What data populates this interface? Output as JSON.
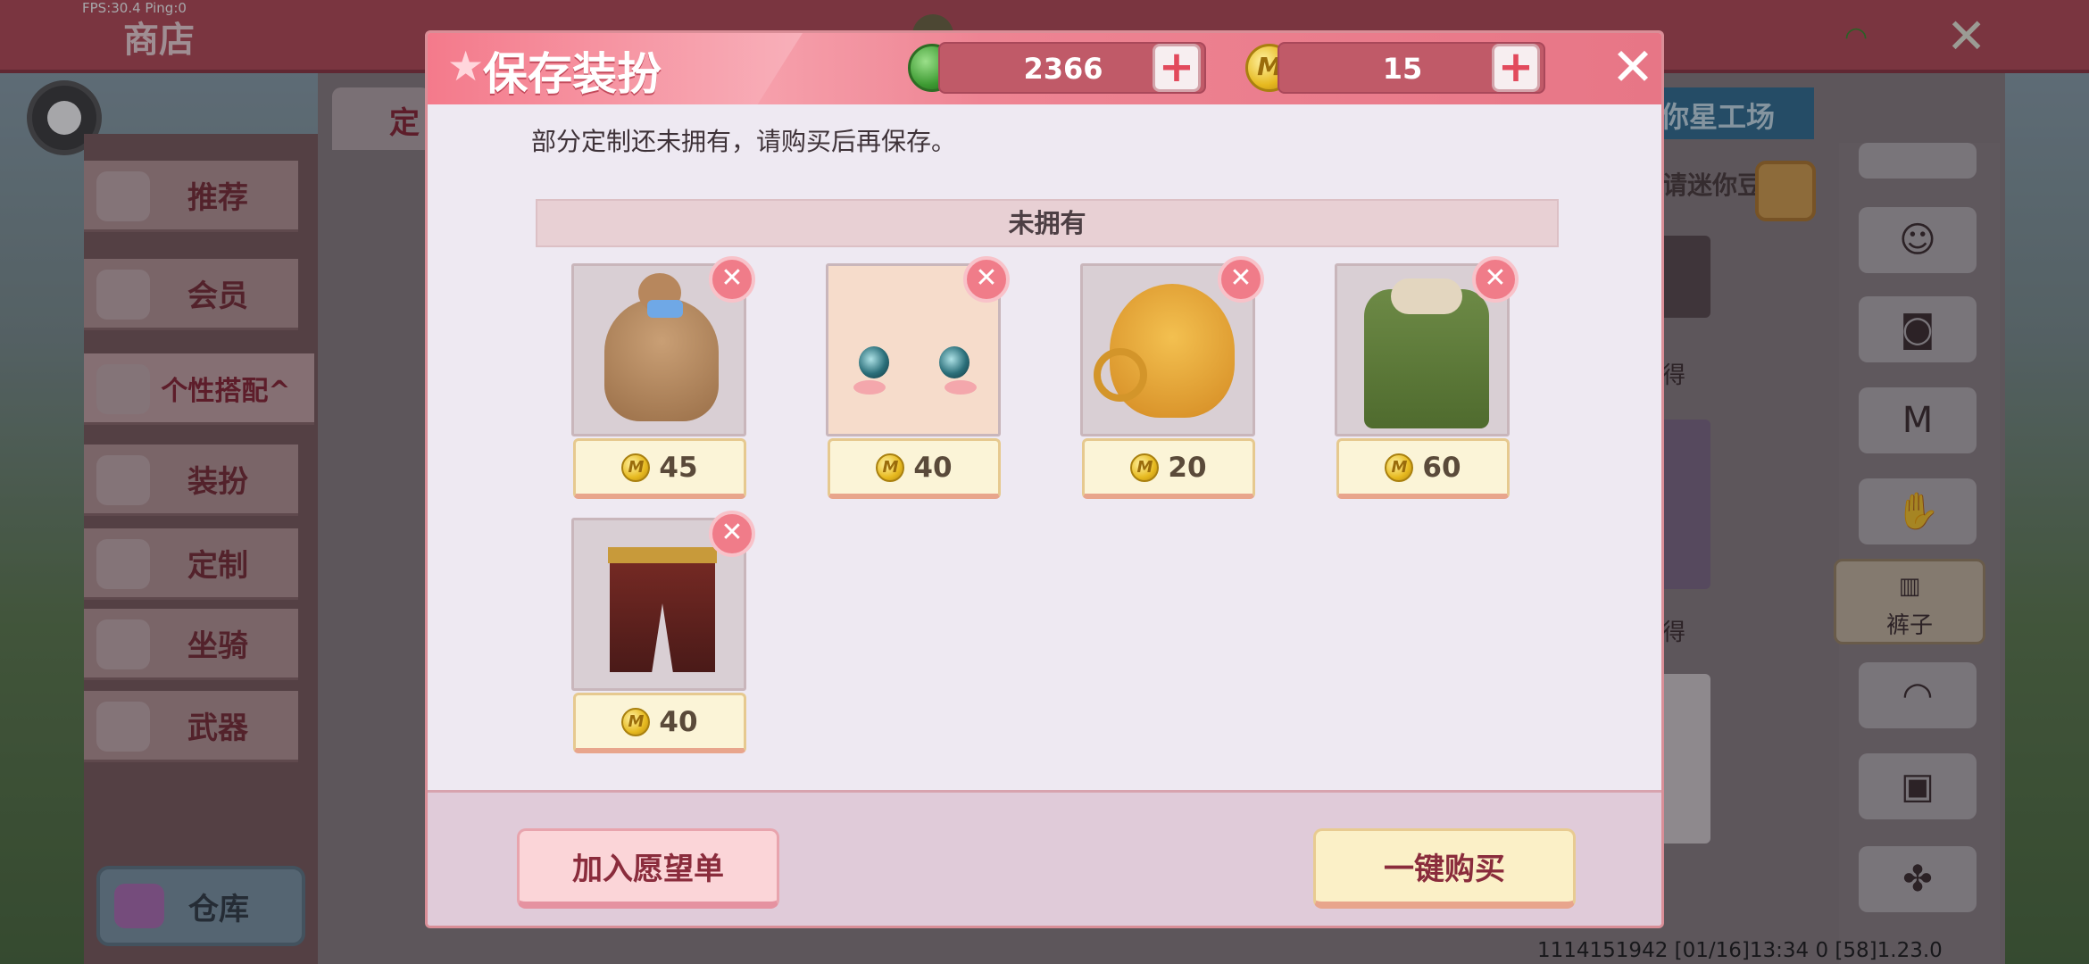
{
  "debug": {
    "fps": "FPS:30.4  Ping:0"
  },
  "background": {
    "shop_title": "商店",
    "tab_left": "定",
    "tab_right": "你星工场",
    "search_hint": "请迷你豆",
    "sidebar": [
      {
        "label": "推荐"
      },
      {
        "label": "会员"
      },
      {
        "label": "个性搭配^"
      },
      {
        "label": "装扮"
      },
      {
        "label": "定制"
      },
      {
        "label": "坐骑"
      },
      {
        "label": "武器"
      }
    ],
    "warehouse": "仓库",
    "right_panel_active": "裤子",
    "partial_char": "得",
    "footer": "1114151942      [01/16]13:34 0    [58]1.23.0"
  },
  "dialog": {
    "title": "保存装扮",
    "gems": "2366",
    "coins": "15",
    "coin_symbol": "M",
    "notice": "部分定制还未拥有，请购买后再保存。",
    "section_header": "未拥有",
    "items": [
      {
        "name": "hair",
        "price": "45"
      },
      {
        "name": "face",
        "price": "40"
      },
      {
        "name": "dog-accessory",
        "price": "20"
      },
      {
        "name": "coat",
        "price": "60"
      },
      {
        "name": "pants",
        "price": "40"
      }
    ],
    "wishlist_button": "加入愿望单",
    "buy_button": "一键购买"
  }
}
